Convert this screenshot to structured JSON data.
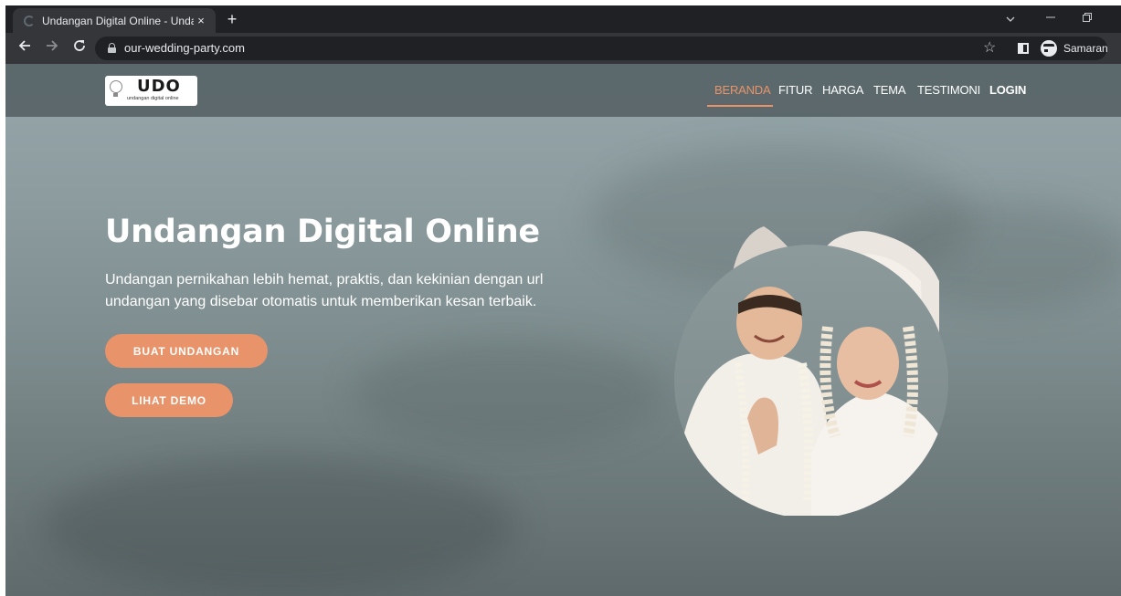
{
  "browser": {
    "tab_title": "Undangan Digital Online - Undan",
    "tab_close": "×",
    "new_tab": "+",
    "url": "our-wedding-party.com",
    "profile_label": "Samaran",
    "icons": [
      "back-icon",
      "forward-icon",
      "reload-icon",
      "lock-icon",
      "star-icon",
      "side-panel-icon",
      "incognito-icon"
    ]
  },
  "site": {
    "logo_text": "UDO",
    "logo_sub": "undangan digital online",
    "nav": [
      {
        "label": "BERANDA",
        "active": true
      },
      {
        "label": "FITUR"
      },
      {
        "label": "HARGA"
      },
      {
        "label": "TEMA"
      },
      {
        "label": "TESTIMONI"
      },
      {
        "label": "LOGIN"
      }
    ],
    "accent_color": "#e8936a"
  },
  "hero": {
    "title": "Undangan Digital Online",
    "subtitle": "Undangan pernikahan lebih hemat, praktis, dan kekinian dengan url undangan yang disebar otomatis untuk memberikan kesan terbaik.",
    "primary_button": "BUAT UNDANGAN",
    "secondary_button": "LIHAT DEMO"
  }
}
